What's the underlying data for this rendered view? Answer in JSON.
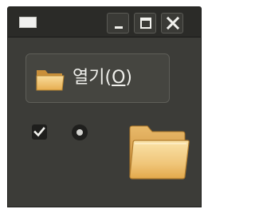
{
  "window": {
    "buttons": {
      "minimize_icon": "minimize-icon",
      "maximize_icon": "maximize-icon",
      "close_icon": "close-icon"
    }
  },
  "open_button": {
    "label": "열기(",
    "mnemonic": "O",
    "label_end": ")",
    "icon": "folder-icon"
  },
  "controls": {
    "checkbox_checked": true,
    "radio_selected": true
  },
  "large_icon": "folder-icon",
  "colors": {
    "window_bg": "#3c3c38",
    "titlebar_bg": "#2b2b28",
    "folder_light": "#f5d592",
    "folder_dark": "#e3a94b",
    "text": "#f0f0ec"
  }
}
